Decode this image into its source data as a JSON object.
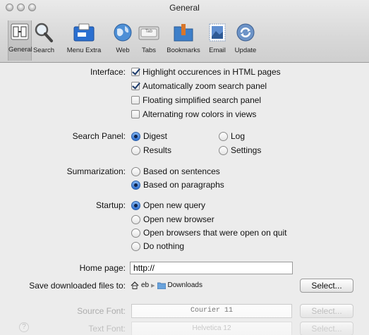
{
  "window": {
    "title": "General"
  },
  "toolbar": [
    {
      "label": "General",
      "icon": "general-icon"
    },
    {
      "label": "Search",
      "icon": "search-icon"
    },
    {
      "label": "Menu Extra",
      "icon": "menu-extra-icon"
    },
    {
      "label": "Web",
      "icon": "globe-icon"
    },
    {
      "label": "Tabs",
      "icon": "tabs-icon"
    },
    {
      "label": "Bookmarks",
      "icon": "bookmarks-folder-icon"
    },
    {
      "label": "Email",
      "icon": "email-stamp-icon"
    },
    {
      "label": "Update",
      "icon": "update-icon"
    }
  ],
  "toolbar_tab_badge": "Tab",
  "interface": {
    "label": "Interface:",
    "options": [
      {
        "text": "Highlight occurences in HTML pages",
        "checked": true
      },
      {
        "text": "Automatically zoom search panel",
        "checked": true
      },
      {
        "text": "Floating simplified search panel",
        "checked": false
      },
      {
        "text": "Alternating row colors in views",
        "checked": false
      }
    ]
  },
  "search_panel": {
    "label": "Search Panel:",
    "options": [
      "Digest",
      "Log",
      "Results",
      "Settings"
    ],
    "selected": "Digest"
  },
  "summarization": {
    "label": "Summarization:",
    "options": [
      "Based on sentences",
      "Based on paragraphs"
    ],
    "selected": "Based on paragraphs"
  },
  "startup": {
    "label": "Startup:",
    "options": [
      "Open new query",
      "Open new browser",
      "Open browsers that were open on quit",
      "Do nothing"
    ],
    "selected": "Open new query"
  },
  "home_page": {
    "label": "Home page:",
    "value": "http://"
  },
  "downloads": {
    "label": "Save downloaded files to:",
    "path_home": "eb",
    "path_folder": "Downloads",
    "button": "Select..."
  },
  "source_font": {
    "label": "Source Font:",
    "value": "Courier 11",
    "button": "Select..."
  },
  "text_font": {
    "label": "Text Font:",
    "value": "Helvetica 12",
    "button": "Select..."
  },
  "help": "?"
}
